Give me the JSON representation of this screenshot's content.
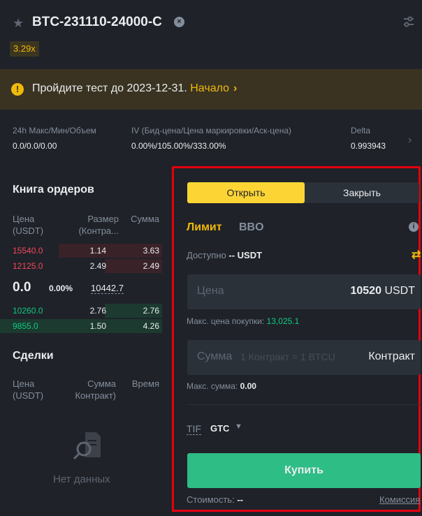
{
  "header": {
    "symbol": "BTC-231110-24000-C",
    "leverage": "3.29x",
    "favorite_icon": "star-icon",
    "remove_icon": "close-circle-icon",
    "settings_icon": "sliders-icon"
  },
  "banner": {
    "text": "Пройдите тест до 2023-12-31.",
    "link": "Начало",
    "arrow": "›"
  },
  "stats": {
    "range_label": "24h Макс/Мин/Объем",
    "range_value": "0.0/0.0/0.00",
    "iv_label": "IV (Бид-цена/Цена маркировки/Аск-цена)",
    "iv_value": "0.00%/105.00%/333.00%",
    "delta_label": "Delta",
    "delta_value": "0.993943"
  },
  "order_book": {
    "title": "Книга ордеров",
    "col_price": "Цена (USDT)",
    "col_size": "Размер (Контра...",
    "col_total": "Сумма",
    "asks": [
      {
        "price": "15540.0",
        "size": "1.14",
        "total": "3.63"
      },
      {
        "price": "12125.0",
        "size": "2.49",
        "total": "2.49"
      }
    ],
    "last_price": "0.0",
    "change": "0.00%",
    "mark_price": "10442.7",
    "bids": [
      {
        "price": "10260.0",
        "size": "2.76",
        "total": "2.76"
      },
      {
        "price": "9855.0",
        "size": "1.50",
        "total": "4.26"
      }
    ]
  },
  "trades": {
    "title": "Сделки",
    "col_price": "Цена (USDT)",
    "col_amount": "Сумма Контракт)",
    "col_time": "Время",
    "empty": "Нет данных"
  },
  "order_form": {
    "tab_open": "Открыть",
    "tab_close": "Закрыть",
    "type_limit": "Лимит",
    "type_bbo": "BBO",
    "available_label": "Доступно",
    "available_value": "-- USDT",
    "price_placeholder": "Цена",
    "price_value": "10520",
    "price_unit": "USDT",
    "max_buy_label": "Макс. цена покупки:",
    "max_buy_value": "13,025.1",
    "amount_placeholder": "Сумма",
    "amount_hint": "1 Контракт = 1 BTCU",
    "amount_unit": "Контракт",
    "max_amount_label": "Макс. сумма:",
    "max_amount_value": "0.00",
    "tif_label": "TIF",
    "tif_value": "GTC",
    "buy_label": "Купить",
    "cost_label": "Стоимость:",
    "cost_value": "--",
    "fee_link": "Комиссия"
  },
  "colors": {
    "accent": "#fcd535",
    "buy": "#2ebd85",
    "sell": "#f6465d",
    "highlight_border": "#e3000f"
  }
}
